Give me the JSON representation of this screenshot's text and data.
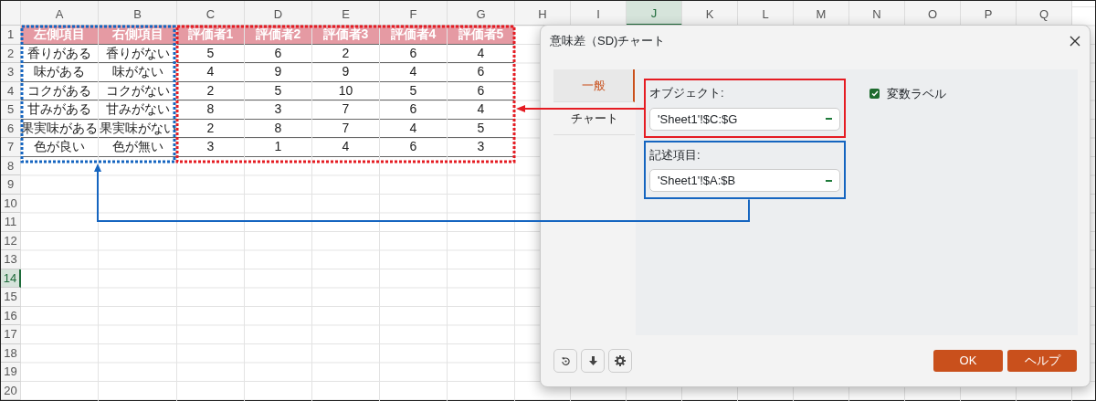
{
  "spreadsheet": {
    "columns": [
      {
        "label": "A",
        "selected": false
      },
      {
        "label": "B",
        "selected": false
      },
      {
        "label": "C",
        "selected": false
      },
      {
        "label": "D",
        "selected": false
      },
      {
        "label": "E",
        "selected": false
      },
      {
        "label": "F",
        "selected": false
      },
      {
        "label": "G",
        "selected": false
      },
      {
        "label": "H",
        "selected": false
      },
      {
        "label": "I",
        "selected": false
      },
      {
        "label": "J",
        "selected": true
      },
      {
        "label": "K",
        "selected": false
      },
      {
        "label": "L",
        "selected": false
      },
      {
        "label": "M",
        "selected": false
      },
      {
        "label": "N",
        "selected": false
      },
      {
        "label": "O",
        "selected": false
      },
      {
        "label": "P",
        "selected": false
      },
      {
        "label": "Q",
        "selected": false
      }
    ],
    "rows": [
      {
        "label": "1",
        "selected": false
      },
      {
        "label": "2",
        "selected": false
      },
      {
        "label": "3",
        "selected": false
      },
      {
        "label": "4",
        "selected": false
      },
      {
        "label": "5",
        "selected": false
      },
      {
        "label": "6",
        "selected": false
      },
      {
        "label": "7",
        "selected": false
      },
      {
        "label": "8",
        "selected": false
      },
      {
        "label": "9",
        "selected": false
      },
      {
        "label": "10",
        "selected": false
      },
      {
        "label": "11",
        "selected": false
      },
      {
        "label": "12",
        "selected": false
      },
      {
        "label": "13",
        "selected": false
      },
      {
        "label": "14",
        "selected": true
      },
      {
        "label": "15",
        "selected": false
      },
      {
        "label": "16",
        "selected": false
      },
      {
        "label": "17",
        "selected": false
      },
      {
        "label": "18",
        "selected": false
      },
      {
        "label": "19",
        "selected": false
      },
      {
        "label": "20",
        "selected": false
      }
    ],
    "table": {
      "header": [
        "左側項目",
        "右側項目",
        "評価者1",
        "評価者2",
        "評価者3",
        "評価者4",
        "評価者5"
      ],
      "rows": [
        [
          "香りがある",
          "香りがない",
          "5",
          "6",
          "2",
          "6",
          "4"
        ],
        [
          "味がある",
          "味がない",
          "4",
          "9",
          "9",
          "4",
          "6"
        ],
        [
          "コクがある",
          "コクがない",
          "2",
          "5",
          "10",
          "5",
          "6"
        ],
        [
          "甘みがある",
          "甘みがない",
          "8",
          "3",
          "7",
          "6",
          "4"
        ],
        [
          "果実味がある",
          "果実味がない",
          "2",
          "8",
          "7",
          "4",
          "5"
        ],
        [
          "色が良い",
          "色が無い",
          "3",
          "1",
          "4",
          "6",
          "3"
        ]
      ]
    }
  },
  "annotations": [
    {
      "kind": "dotted-box",
      "color": "#1565c0"
    },
    {
      "kind": "dotted-box",
      "color": "#e51c23"
    },
    {
      "kind": "arrow",
      "color": "#e51c23"
    },
    {
      "kind": "connector",
      "color": "#1565c0"
    }
  ],
  "dialog": {
    "title": "意味差（SD)チャート",
    "nav": [
      {
        "label": "一般",
        "selected": true
      },
      {
        "label": "チャート",
        "selected": false
      }
    ],
    "fields": [
      {
        "label": "オブジェクト:",
        "value": "'Sheet1'!$C:$G",
        "color": "#e51c23"
      },
      {
        "label": "記述項目:",
        "value": "'Sheet1'!$A:$B",
        "color": "#1565c0"
      }
    ],
    "checkbox": {
      "label": "変数ラベル",
      "checked": true
    },
    "buttons": [
      "OK",
      "ヘルプ"
    ]
  }
}
